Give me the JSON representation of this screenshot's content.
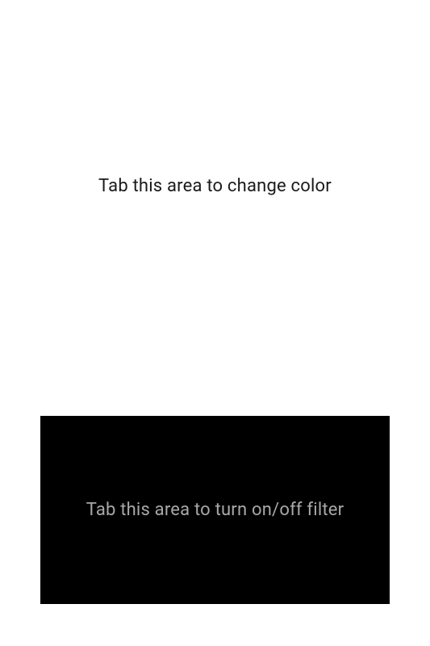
{
  "colorArea": {
    "label": "Tab this area to change color"
  },
  "filterArea": {
    "label": "Tab this area to turn on/off filter"
  }
}
